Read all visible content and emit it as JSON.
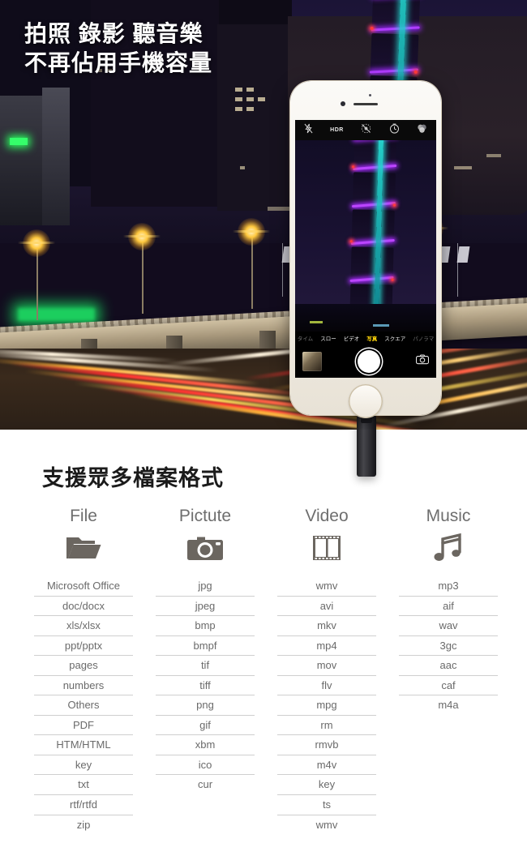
{
  "hero": {
    "headline_line1": "拍照 錄影 聽音樂",
    "headline_line2": "不再佔用手機容量",
    "phone": {
      "camera_ui": {
        "top_icons": [
          "flash-off-icon",
          "hdr-icon",
          "live-photo-off-icon",
          "timer-icon",
          "filters-icon"
        ],
        "hdr_label": "HDR",
        "modes": [
          "タイム",
          "スロー",
          "ビデオ",
          "写真",
          "スクエア",
          "パノラマ"
        ],
        "active_mode": "写真",
        "active_mode_color": "#ffd60a",
        "thumbnail": "last-photo-thumbnail",
        "shutter": "shutter-button",
        "flip": "flip-camera-icon"
      }
    },
    "accessory": "usb-flash-drive-dongle"
  },
  "formats": {
    "title": "支援眾多檔案格式",
    "columns": [
      {
        "head": "File",
        "icon": "folder-icon",
        "items": [
          "Microsoft Office",
          "doc/docx",
          "xls/xlsx",
          "ppt/pptx",
          "pages",
          "numbers",
          "Others",
          "PDF",
          "HTM/HTML",
          "key",
          "txt",
          "rtf/rtfd",
          "zip"
        ]
      },
      {
        "head": "Pictute",
        "icon": "camera-icon",
        "items": [
          "jpg",
          "jpeg",
          "bmp",
          "bmpf",
          "tif",
          "tiff",
          "png",
          "gif",
          "xbm",
          "ico",
          "cur"
        ]
      },
      {
        "head": "Video",
        "icon": "film-strip-icon",
        "items": [
          "wmv",
          "avi",
          "mkv",
          "mp4",
          "mov",
          "flv",
          "mpg",
          "rm",
          "rmvb",
          "m4v",
          "key",
          "ts",
          "wmv"
        ]
      },
      {
        "head": "Music",
        "icon": "music-note-icon",
        "items": [
          "mp3",
          "aif",
          "wav",
          "3gc",
          "aac",
          "caf",
          "m4a"
        ]
      }
    ]
  },
  "colors": {
    "headline_text": "#ffffff",
    "section_title": "#1b1b1b",
    "column_head": "#6e6e6e",
    "format_text": "#6a6a6a",
    "divider": "#cfcfcf",
    "accent_mode": "#ffd60a"
  }
}
